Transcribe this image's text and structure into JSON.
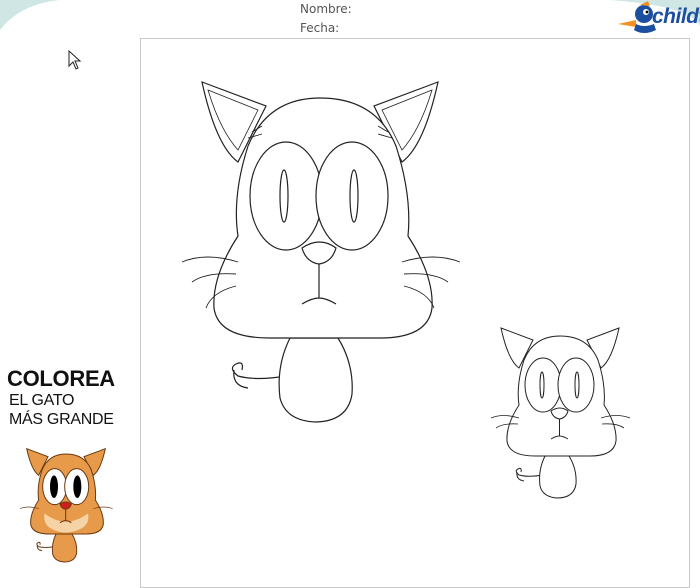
{
  "header": {
    "name_label": "Nombre:",
    "date_label": "Fecha:",
    "logo_text": "childt"
  },
  "sidebar": {
    "title": "COLOREA",
    "line1": "EL GATO",
    "line2": "MÁS GRANDE"
  },
  "colors": {
    "frame_teal": "#cfe6e4",
    "sheet_border": "#c9c9c9",
    "cat_orange": "#e79a4a",
    "logo_blue": "#1d4fa0",
    "logo_orange": "#f19222"
  },
  "icons": [
    "mouse-pointer-icon",
    "childtopia-logo",
    "cat-illustration"
  ]
}
